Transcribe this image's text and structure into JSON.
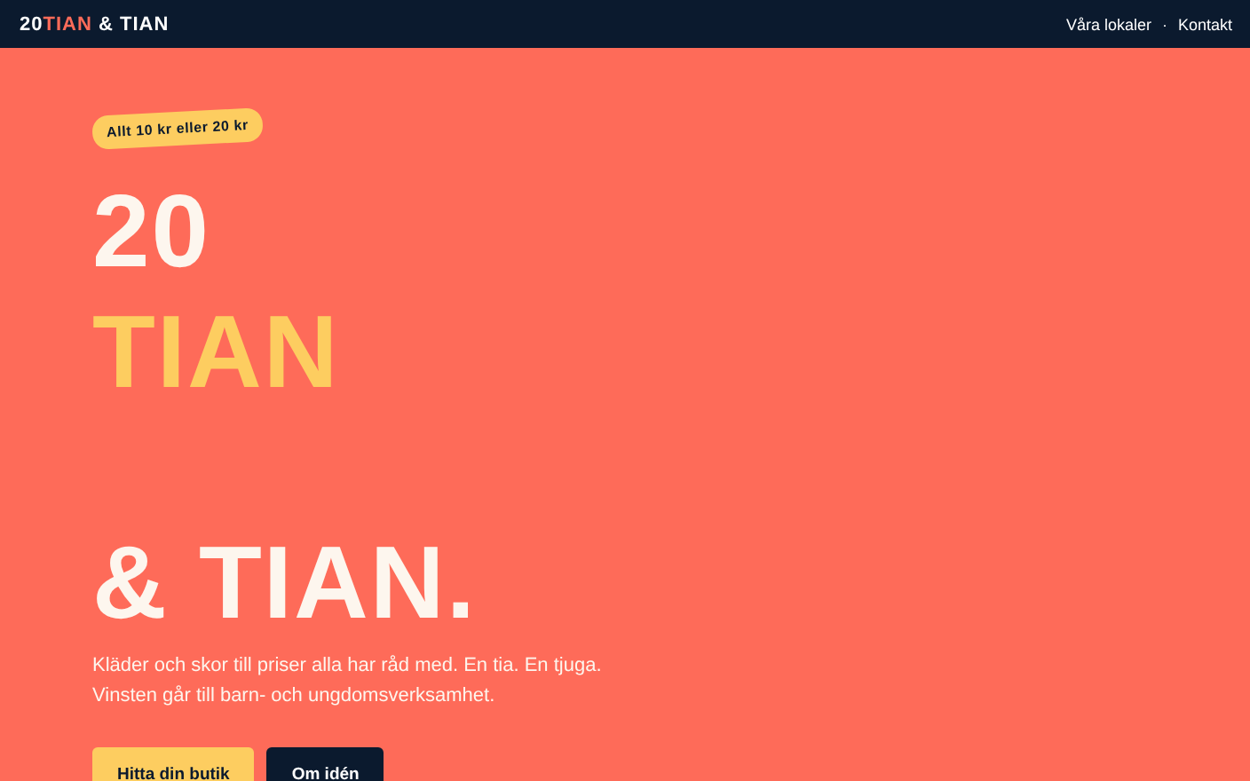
{
  "header": {
    "logo": [
      {
        "text": "20",
        "accent": false
      },
      {
        "text": "TIAN",
        "accent": true
      },
      {
        "text": " & TIAN",
        "accent": false
      }
    ],
    "nav": [
      "Våra lokaler",
      "Kontakt"
    ],
    "separator": "·"
  },
  "hero": {
    "badge": "Allt 10 kr eller 20 kr",
    "headline_groups": [
      [
        {
          "text": "20",
          "accent": false
        },
        {
          "text": "TIAN",
          "accent": true
        }
      ],
      [
        {
          "text": "& TIAN.",
          "accent": false
        }
      ]
    ],
    "paragraph": [
      "Kläder och skor till priser alla har råd med. En tia. En tjuga.",
      "Vinsten går till barn- och ungdomsverksamhet."
    ],
    "buttons": [
      {
        "label": "Hitta din butik",
        "kind": "primary"
      },
      {
        "label": "Om idén",
        "kind": "secondary"
      }
    ]
  }
}
